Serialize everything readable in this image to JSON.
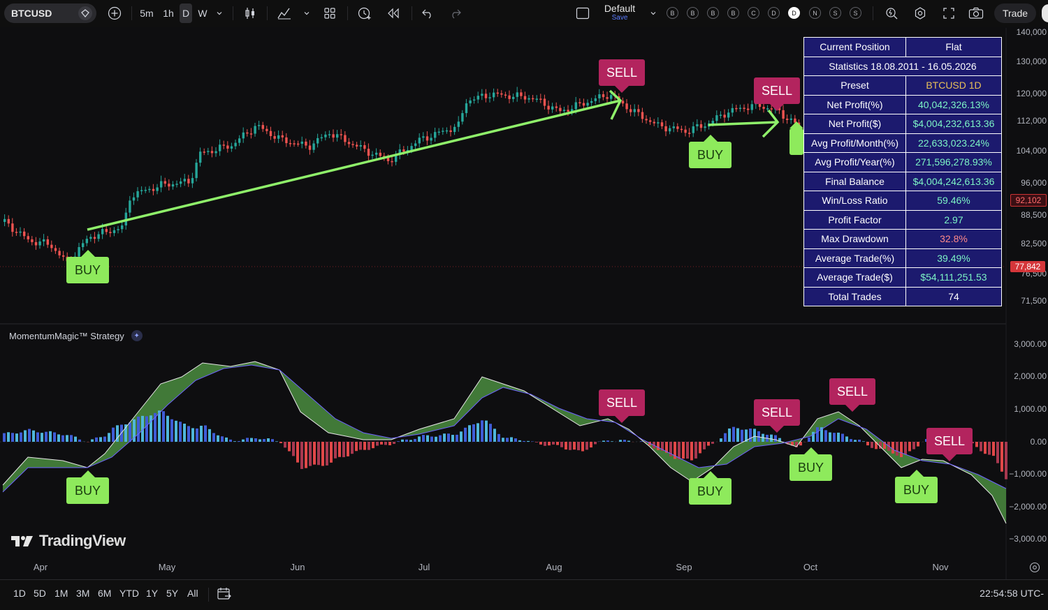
{
  "toolbar": {
    "symbol": "BTCUSD",
    "intervals": [
      "5m",
      "1h",
      "D",
      "W"
    ],
    "active_interval": "D",
    "preset_name": "Default",
    "preset_sub": "Save",
    "letter_buttons": [
      "B",
      "B",
      "B",
      "B",
      "C",
      "D",
      "D",
      "N",
      "S",
      "S"
    ],
    "active_letter_index": 6,
    "trade_label": "Trade"
  },
  "price_axis": {
    "labels": [
      "140,000",
      "130,000",
      "120,000",
      "112,000",
      "104,000",
      "96,000",
      "88,500",
      "82,500",
      "76,500",
      "71,500"
    ],
    "current_price": "92,102",
    "marked_price": "77,842"
  },
  "indicator_axis": {
    "labels": [
      "3,000.00",
      "2,000.00",
      "1,000.00",
      "0.00",
      "−1,000.00",
      "−2,000.00",
      "−3,000.00"
    ]
  },
  "time_axis": {
    "labels": [
      "Apr",
      "May",
      "Jun",
      "Jul",
      "Aug",
      "Sep",
      "Oct",
      "Nov"
    ]
  },
  "indicator": {
    "name": "MomentumMagic™ Strategy",
    "badge_icon": "sparkle-icon"
  },
  "signals": {
    "price": [
      {
        "type": "buy",
        "label": "BUY"
      },
      {
        "type": "sell",
        "label": "SELL"
      },
      {
        "type": "buy",
        "label": "BUY"
      },
      {
        "type": "sell",
        "label": "SELL"
      }
    ],
    "indicator": [
      {
        "type": "buy",
        "label": "BUY"
      },
      {
        "type": "sell",
        "label": "SELL"
      },
      {
        "type": "buy",
        "label": "BUY"
      },
      {
        "type": "sell",
        "label": "SELL"
      },
      {
        "type": "buy",
        "label": "BUY"
      },
      {
        "type": "sell",
        "label": "SELL"
      },
      {
        "type": "buy",
        "label": "BUY"
      },
      {
        "type": "sell",
        "label": "SELL"
      }
    ]
  },
  "stats": {
    "rows": [
      {
        "label": "Current Position",
        "value": "Flat"
      },
      {
        "label": "Statistics 18.08.2011 - 16.05.2026",
        "value": ""
      },
      {
        "label": "Preset",
        "value": "BTCUSD 1D"
      },
      {
        "label": "Net Profit(%)",
        "value": "40,042,326.13%"
      },
      {
        "label": "Net Profit($)",
        "value": "$4,004,232,613.36"
      },
      {
        "label": "Avg Profit/Month(%)",
        "value": "22,633,023.24%"
      },
      {
        "label": "Avg Profit/Year(%)",
        "value": "271,596,278.93%"
      },
      {
        "label": "Final Balance",
        "value": "$4,004,242,613.36"
      },
      {
        "label": "Win/Loss Ratio",
        "value": "59.46%"
      },
      {
        "label": "Profit Factor",
        "value": "2.97"
      },
      {
        "label": "Max Drawdown",
        "value": "32.8%"
      },
      {
        "label": "Average Trade(%)",
        "value": "39.49%"
      },
      {
        "label": "Average Trade($)",
        "value": "$54,111,251.53"
      },
      {
        "label": "Total Trades",
        "value": "74"
      }
    ]
  },
  "branding": {
    "logo_text": "TradingView"
  },
  "bottombar": {
    "ranges": [
      "1D",
      "5D",
      "1M",
      "3M",
      "6M",
      "YTD",
      "1Y",
      "5Y",
      "All"
    ],
    "clock": "22:54:58 UTC-"
  },
  "colors": {
    "up_candle": "#26a69a",
    "down_candle": "#ef5350",
    "buy": "#8eea5c",
    "sell": "#b3245e",
    "table_bg": "#1c1a6e",
    "hist_pos": "#3f5bd6",
    "hist_neg": "#e04848"
  }
}
